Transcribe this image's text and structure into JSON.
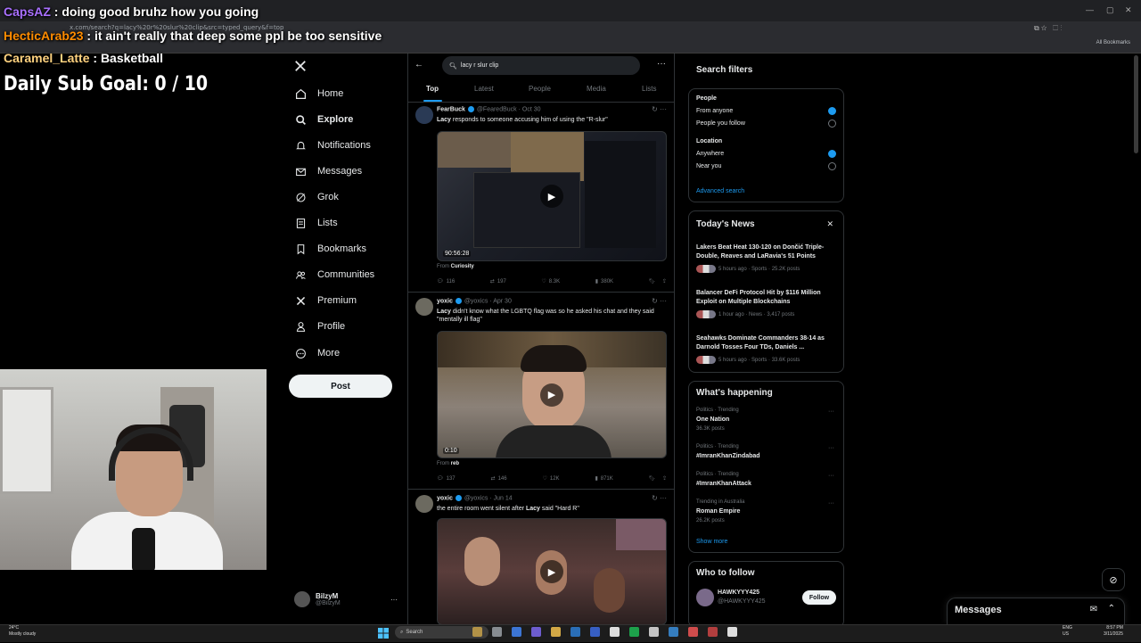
{
  "browser": {
    "url": "x.com/search?q=lacy%20r%20slur%20clip&src=typed_query&f=top",
    "bookmarks_label": "All Bookmarks"
  },
  "overlay": {
    "chat": [
      {
        "user": "CapsAZ",
        "text": ": doing good bruhz how you going",
        "color": "#a970ff"
      },
      {
        "user": "HecticArab23",
        "text": ": it ain't really that deep some ppl be too sensitive",
        "color": "#ff8c00"
      },
      {
        "user": "Caramel_Latte",
        "text": ": Basketball",
        "color": "#ffd27f"
      }
    ],
    "sub_goal": "Daily Sub Goal:  0 / 10"
  },
  "nav": {
    "items": [
      {
        "label": "Home",
        "icon": "home-icon"
      },
      {
        "label": "Explore",
        "icon": "search-icon",
        "active": true
      },
      {
        "label": "Notifications",
        "icon": "bell-icon"
      },
      {
        "label": "Messages",
        "icon": "mail-icon"
      },
      {
        "label": "Grok",
        "icon": "grok-icon"
      },
      {
        "label": "Lists",
        "icon": "list-icon"
      },
      {
        "label": "Bookmarks",
        "icon": "bookmark-icon"
      },
      {
        "label": "Communities",
        "icon": "people-icon"
      },
      {
        "label": "Premium",
        "icon": "x-logo-icon"
      },
      {
        "label": "Profile",
        "icon": "person-icon"
      },
      {
        "label": "More",
        "icon": "more-circle-icon"
      }
    ],
    "post_label": "Post",
    "account": {
      "name": "BilzyM",
      "handle": "@BilzyM"
    }
  },
  "search": {
    "query": "lacy r slur clip",
    "tabs": [
      "Top",
      "Latest",
      "People",
      "Media",
      "Lists"
    ]
  },
  "tweets": [
    {
      "name": "FearBuck",
      "handle": "@FearedBuck",
      "date": "· Oct 30",
      "text_bold": "Lacy",
      "text": " responds to someone accusing him of using the \"R-slur\"",
      "duration": "90:56:28",
      "from": "Curiosity",
      "replies": "116",
      "reposts": "197",
      "likes": "8.3K",
      "views": "380K"
    },
    {
      "name": "yoxic",
      "handle": "@yoxics",
      "date": "· Apr 30",
      "text_bold": "Lacy",
      "text": " didn't know what the LGBTQ flag was so he asked his chat and they said \"mentally ill flag\"",
      "duration": "0:10",
      "from": "reb",
      "replies": "137",
      "reposts": "146",
      "likes": "12K",
      "views": "871K"
    },
    {
      "name": "yoxic",
      "handle": "@yoxics",
      "date": "· Jun 14",
      "text_pre": "the entire room went silent after ",
      "text_bold": "Lacy",
      "text": " said \"Hard R\""
    }
  ],
  "search_filters": {
    "title": "Search filters",
    "people_label": "People",
    "people_opts": [
      "From anyone",
      "People you follow"
    ],
    "location_label": "Location",
    "location_opts": [
      "Anywhere",
      "Near you"
    ],
    "advanced": "Advanced search"
  },
  "todays_news": {
    "title": "Today's News",
    "items": [
      {
        "title": "Lakers Beat Heat 130-120 on Dončić Triple-Double, Reaves and LaRavia's 51 Points",
        "meta": "5 hours ago · Sports · 25.2K posts"
      },
      {
        "title": "Balancer DeFi Protocol Hit by $116 Million Exploit on Multiple Blockchains",
        "meta": "1 hour ago · News · 3,417 posts"
      },
      {
        "title": "Seahawks Dominate Commanders 38-14 as Darnold Tosses Four TDs, Daniels ...",
        "meta": "5 hours ago · Sports · 33.6K posts"
      }
    ]
  },
  "whats_happening": {
    "title": "What's happening",
    "items": [
      {
        "meta": "Politics · Trending",
        "title": "One Nation",
        "posts": "36.3K posts"
      },
      {
        "meta": "Politics · Trending",
        "title": "#ImranKhanZindabad",
        "posts": ""
      },
      {
        "meta": "Politics · Trending",
        "title": "#ImranKhanAttack",
        "posts": ""
      },
      {
        "meta": "Trending in Australia",
        "title": "Roman Empire",
        "posts": "26.2K posts"
      }
    ],
    "show_more": "Show more"
  },
  "who_to_follow": {
    "title": "Who to follow",
    "name": "HAWKYYY425",
    "handle": "@HAWKYYY425",
    "follow_label": "Follow"
  },
  "messages_drawer": {
    "title": "Messages"
  },
  "taskbar": {
    "weather_temp": "24°C",
    "weather_desc": "Mostly cloudy",
    "search_label": "Search",
    "lang1": "ENG",
    "lang2": "US",
    "time": "8:57 PM",
    "date": "3/11/2025"
  }
}
